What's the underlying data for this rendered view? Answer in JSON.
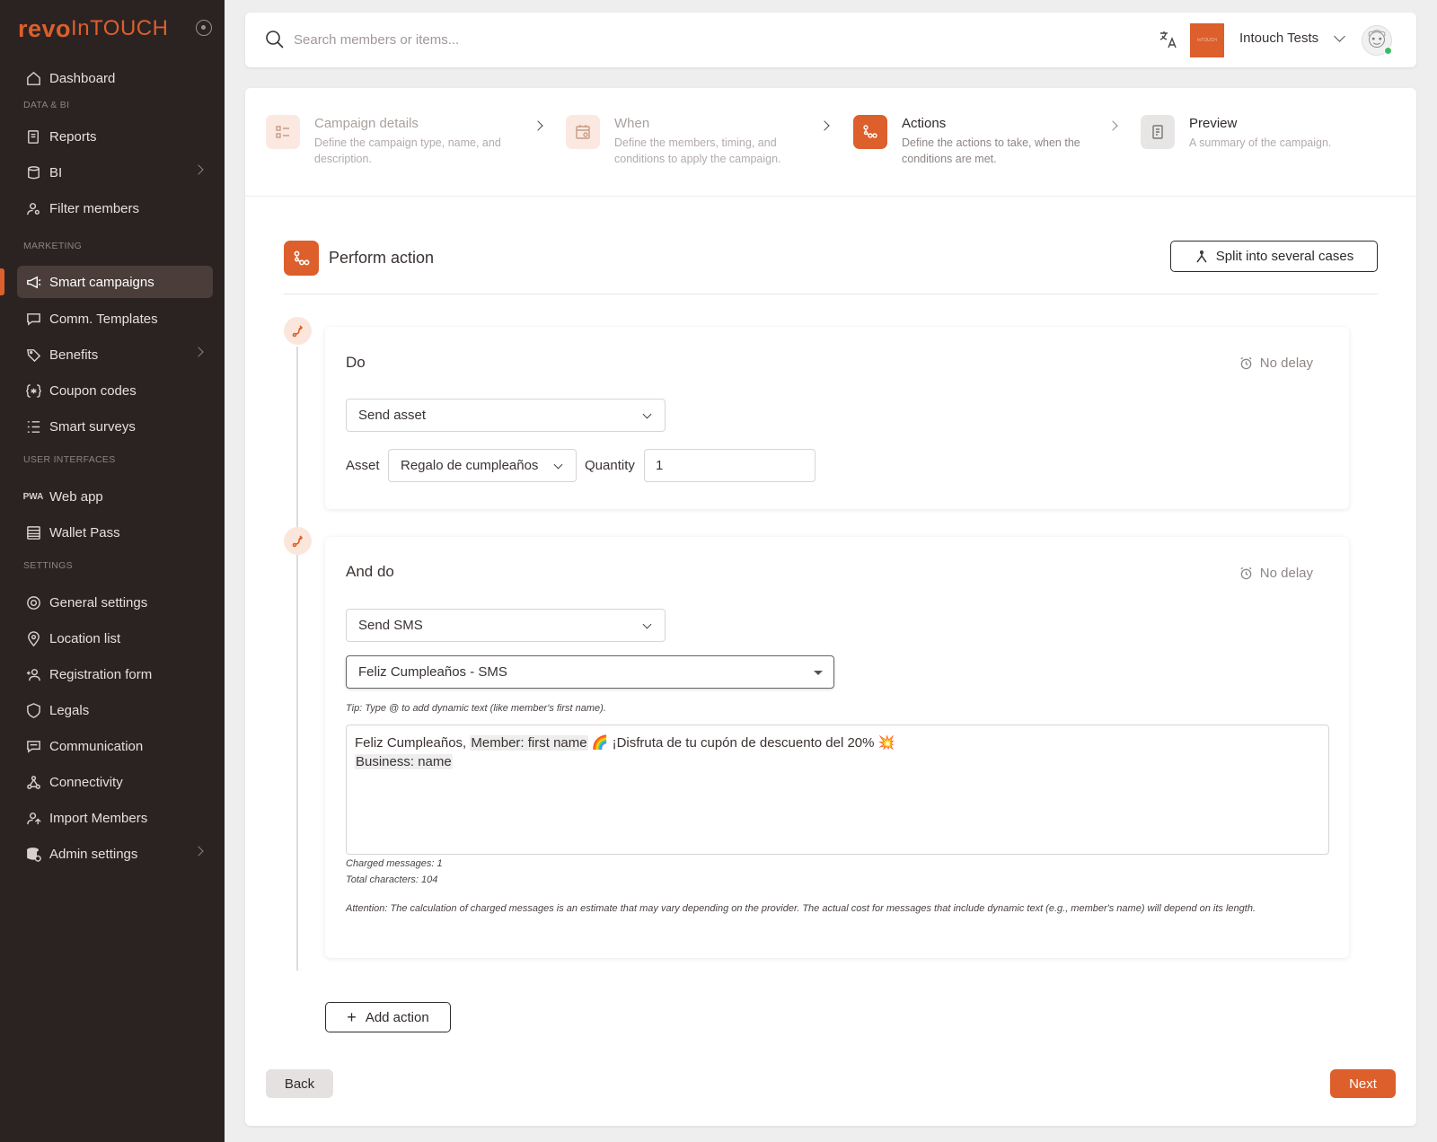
{
  "logo": {
    "part1": "revo",
    "part2": "InTOUCH"
  },
  "sidebar": {
    "items": [
      {
        "label": "Dashboard"
      },
      {
        "label": "Reports"
      },
      {
        "label": "BI"
      },
      {
        "label": "Filter members"
      },
      {
        "label": "Smart campaigns"
      },
      {
        "label": "Comm. Templates"
      },
      {
        "label": "Benefits"
      },
      {
        "label": "Coupon codes"
      },
      {
        "label": "Smart surveys"
      },
      {
        "label": "Web app"
      },
      {
        "label": "Wallet Pass"
      },
      {
        "label": "General settings"
      },
      {
        "label": "Location list"
      },
      {
        "label": "Registration form"
      },
      {
        "label": "Legals"
      },
      {
        "label": "Communication"
      },
      {
        "label": "Connectivity"
      },
      {
        "label": "Import Members"
      },
      {
        "label": "Admin settings"
      }
    ],
    "sections": {
      "data_bi": "DATA & BI",
      "marketing": "MARKETING",
      "user_interfaces": "USER INTERFACES",
      "settings": "SETTINGS"
    }
  },
  "topbar": {
    "search_placeholder": "Search members or items...",
    "org_logo_text": "InTOUCH",
    "org_name": "Intouch Tests"
  },
  "steps": [
    {
      "title": "Campaign details",
      "desc": "Define the campaign type, name, and description."
    },
    {
      "title": "When",
      "desc": "Define the members, timing, and conditions to apply the campaign."
    },
    {
      "title": "Actions",
      "desc": "Define the actions to take, when the conditions are met."
    },
    {
      "title": "Preview",
      "desc": "A summary of the campaign."
    }
  ],
  "section": {
    "title": "Perform action",
    "split_label": "Split into several cases"
  },
  "action1": {
    "title": "Do",
    "delay": "No delay",
    "type": "Send asset",
    "asset_label": "Asset",
    "asset_value": "Regalo de cumpleaños",
    "quantity_label": "Quantity",
    "quantity_value": "1"
  },
  "action2": {
    "title": "And do",
    "delay": "No delay",
    "type": "Send SMS",
    "template": "Feliz Cumpleaños - SMS",
    "tip": "Tip: Type @ to add dynamic text (like member's first name).",
    "message": {
      "t1": "Feliz Cumpleaños, ",
      "v1": "Member: first name",
      "t2": " 🌈 ¡Disfruta de tu cupón de descuento del 20% 💥",
      "v2": "Business: name"
    },
    "charged": "Charged messages: 1",
    "total": "Total characters: 104",
    "attention": "Attention: The calculation of charged messages is an estimate that may vary depending on the provider. The actual cost for messages that include dynamic text (e.g., member's name) will depend on its length."
  },
  "buttons": {
    "add_action": "Add action",
    "back": "Back",
    "next": "Next"
  },
  "colors": {
    "accent": "#dc5f2c",
    "sidebar_bg": "#2b2322"
  }
}
